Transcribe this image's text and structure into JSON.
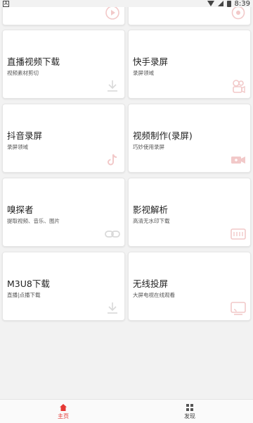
{
  "status_bar": {
    "time": "8:39",
    "app_glyph": "A"
  },
  "colors": {
    "accent": "#e53935",
    "icon_faint": "#f2c9c9",
    "icon_gray": "#d9d9d9"
  },
  "cards": [
    {
      "id": "top-left",
      "title": "",
      "subtitle": "",
      "icon": "video-play-icon"
    },
    {
      "id": "top-right",
      "title": "",
      "subtitle": "",
      "icon": "settings-icon"
    },
    {
      "id": "live-download",
      "title": "直播视频下载",
      "subtitle": "视频素材剪切",
      "icon": "download-icon"
    },
    {
      "id": "kuaishou",
      "title": "快手录屏",
      "subtitle": "录屏领域",
      "icon": "kuaishou-camera-icon"
    },
    {
      "id": "douyin",
      "title": "抖音录屏",
      "subtitle": "录屏领域",
      "icon": "tiktok-icon"
    },
    {
      "id": "video-make",
      "title": "视频制作(录屏)",
      "subtitle": "巧妙使用录屏",
      "icon": "video-camera-icon"
    },
    {
      "id": "sniffer",
      "title": "嗅探者",
      "subtitle": "提取视频、音乐、图片",
      "icon": "link-icon"
    },
    {
      "id": "parse",
      "title": "影视解析",
      "subtitle": "高清无水印下载",
      "icon": "film-icon"
    },
    {
      "id": "m3u8",
      "title": "M3U8下载",
      "subtitle": "直播|点播下载",
      "icon": "download-icon"
    },
    {
      "id": "cast",
      "title": "无线投屏",
      "subtitle": "大屏电视在线观看",
      "icon": "cast-icon"
    }
  ],
  "bottom_nav": [
    {
      "label": "主页",
      "icon": "home-icon",
      "active": true
    },
    {
      "label": "发现",
      "icon": "grid-icon",
      "active": false
    }
  ]
}
